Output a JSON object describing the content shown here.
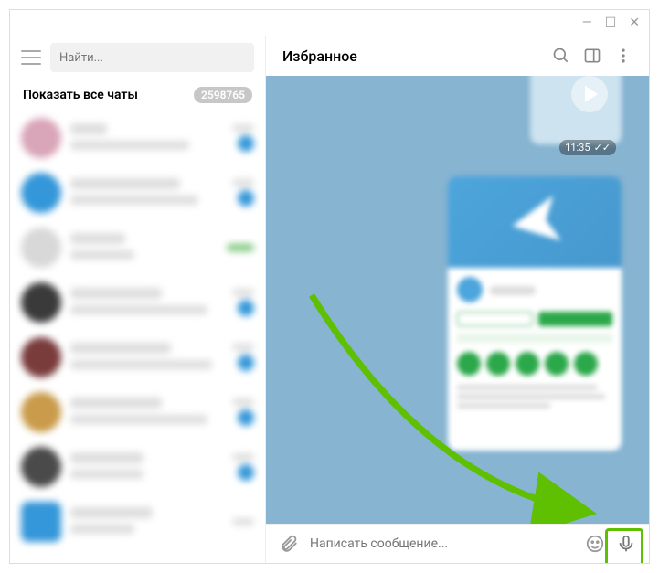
{
  "titlebar": {
    "minimize": "—",
    "maximize": "☐",
    "close": "✕"
  },
  "sidebar": {
    "search_placeholder": "Найти...",
    "filter_label": "Показать все чаты",
    "badge": "2598765",
    "chats": [
      {
        "avatar": "#d9a5b8"
      },
      {
        "avatar": "#3497d9"
      },
      {
        "avatar": "#d8d8d8"
      },
      {
        "avatar": "#3a3a3a"
      },
      {
        "avatar": "#7a3b3b"
      },
      {
        "avatar": "#c99b4a"
      },
      {
        "avatar": "#4a4a4a"
      },
      {
        "avatar": "#3497d9"
      }
    ]
  },
  "header": {
    "title": "Избранное"
  },
  "chat": {
    "time1": "11:35"
  },
  "input": {
    "placeholder": "Написать сообщение..."
  },
  "colors": {
    "highlight": "#5ec000",
    "chat_bg": "#86b4d1",
    "primary": "#3497d9"
  }
}
